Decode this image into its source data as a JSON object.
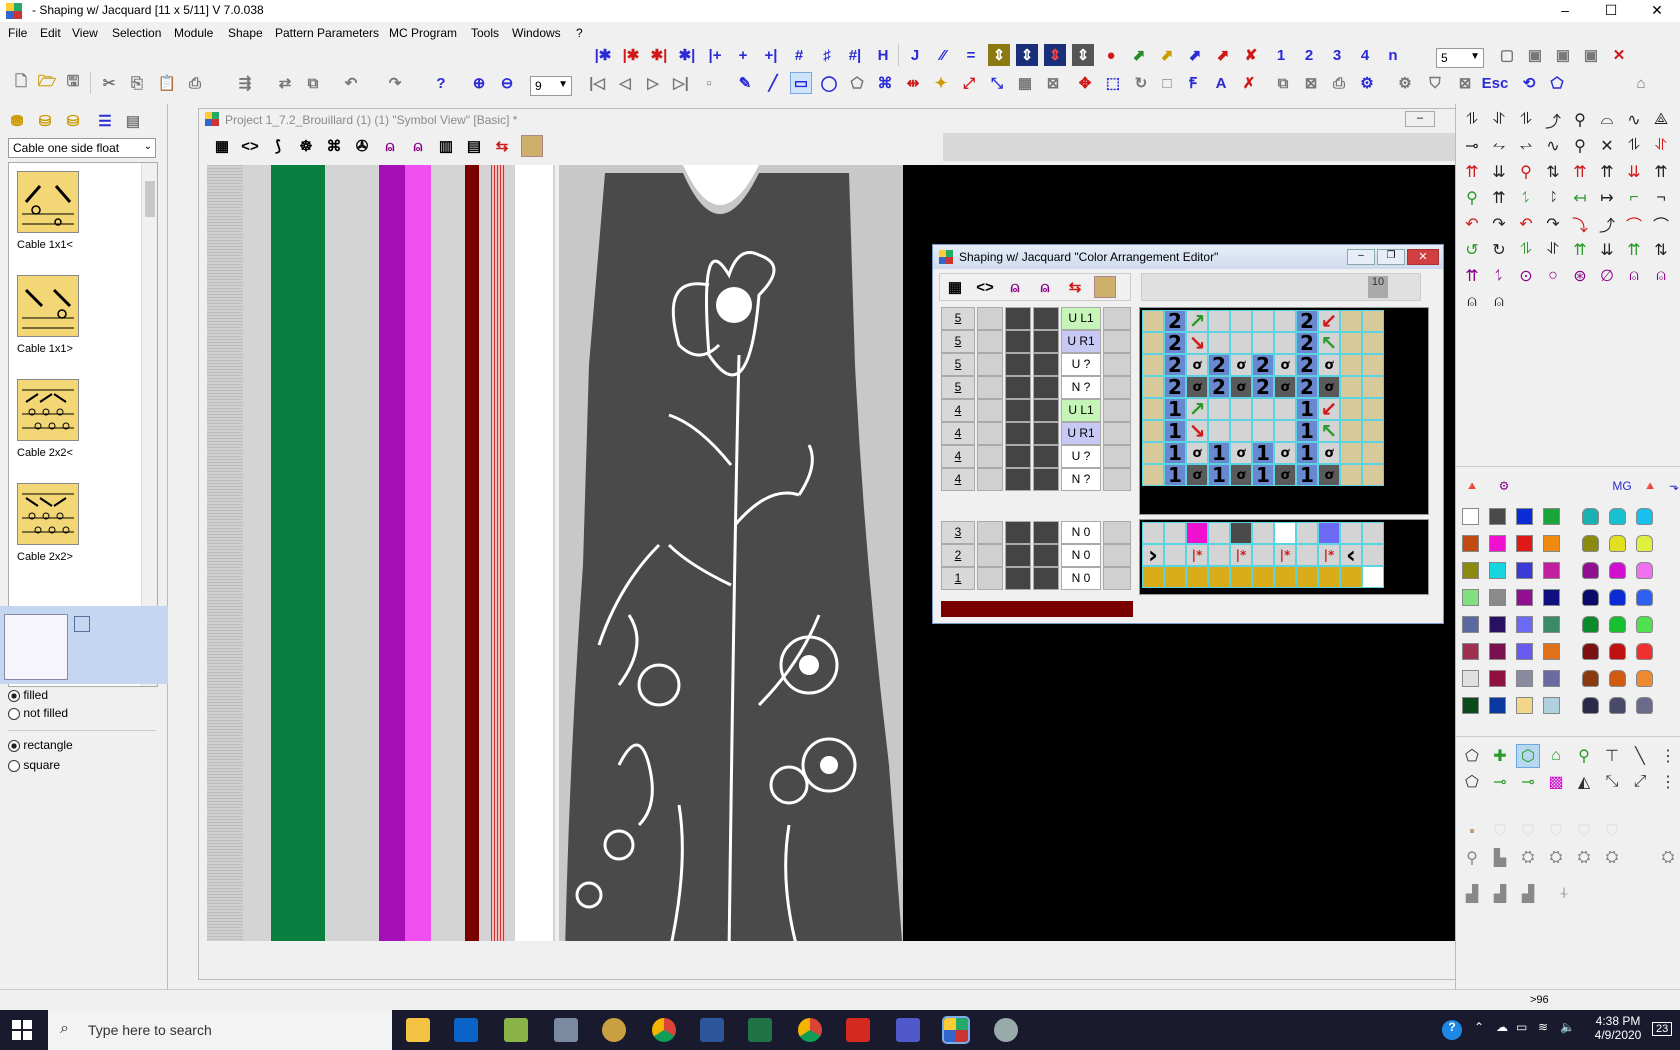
{
  "window": {
    "title": "- Shaping w/ Jacquard [11 x 5/11]   V 7.0.038",
    "min": "–",
    "max": "☐",
    "close": "✕"
  },
  "menu": [
    "File",
    "Edit",
    "View",
    "Selection",
    "Module",
    "Shape",
    "Pattern Parameters",
    "MC Program",
    "Tools",
    "Windows",
    "?"
  ],
  "toolbar": {
    "zoom_value": "9",
    "count_value": "5",
    "numbers": [
      "1",
      "2",
      "3",
      "4",
      "n"
    ],
    "esc_label": "Esc"
  },
  "left_panel": {
    "module_select": "Cable one side float",
    "cables": [
      "Cable 1x1<",
      "Cable 1x1>",
      "Cable 2x2<",
      "Cable 2x2>"
    ],
    "fill_options": [
      "filled",
      "not filled"
    ],
    "fill_selected": "filled",
    "shape_options": [
      "rectangle",
      "square"
    ],
    "shape_selected": "rectangle"
  },
  "document": {
    "title": "Project 1_7.2_Brouillard (1) (1) \"Symbol View\" [Basic] *"
  },
  "colors": {
    "stripes": [
      "#c8c8c8",
      "#d4d4d4",
      "#0a8040",
      "#d4d4d4",
      "#a50fb8",
      "#f050f0",
      "#d4d4d4",
      "#7a0000",
      "#d4d4d4",
      "#ffffff",
      "#d4d4d4"
    ],
    "garment": "#4a4a4a",
    "canvas_bg": "#000000"
  },
  "cae": {
    "title": "Shaping w/ Jacquard \"Color Arrangement Editor\"",
    "ruler_value": "10",
    "rows_top": [
      {
        "num": "5",
        "cmd": "U L1",
        "bg": "#c6f5b8"
      },
      {
        "num": "5",
        "cmd": "U R1",
        "bg": "#c8c8f5"
      },
      {
        "num": "5",
        "cmd": "U ?",
        "bg": "#ffffff"
      },
      {
        "num": "5",
        "cmd": "N ?",
        "bg": "#ffffff"
      },
      {
        "num": "4",
        "cmd": "U L1",
        "bg": "#c6f5b8"
      },
      {
        "num": "4",
        "cmd": "U R1",
        "bg": "#c8c8f5"
      },
      {
        "num": "4",
        "cmd": "U ?",
        "bg": "#ffffff"
      },
      {
        "num": "4",
        "cmd": "N ?",
        "bg": "#ffffff"
      }
    ],
    "rows_bottom": [
      {
        "num": "3",
        "cmd": "N 0",
        "bg": "#ffffff"
      },
      {
        "num": "2",
        "cmd": "N 0",
        "bg": "#ffffff"
      },
      {
        "num": "1",
        "cmd": "N 0",
        "bg": "#ffffff"
      }
    ],
    "grid_rows": [
      [
        "",
        "2",
        "↗",
        "",
        "",
        "",
        "",
        "2",
        "↙",
        "",
        ""
      ],
      [
        "",
        "2",
        "↘",
        "",
        "",
        "",
        "",
        "2",
        "↖",
        "",
        ""
      ],
      [
        "",
        "2",
        "ơ",
        "2",
        "ơ",
        "2",
        "ơ",
        "2",
        "ơ",
        "",
        ""
      ],
      [
        "",
        "2",
        "ơ",
        "2",
        "ơ",
        "2",
        "ơ",
        "2",
        "ơ",
        "",
        ""
      ],
      [
        "",
        "1",
        "↗",
        "",
        "",
        "",
        "",
        "1",
        "↙",
        "",
        ""
      ],
      [
        "",
        "1",
        "↘",
        "",
        "",
        "",
        "",
        "1",
        "↖",
        "",
        ""
      ],
      [
        "",
        "1",
        "ơ",
        "1",
        "ơ",
        "1",
        "ơ",
        "1",
        "ơ",
        "",
        ""
      ],
      [
        "",
        "1",
        "ơ",
        "1",
        "ơ",
        "1",
        "ơ",
        "1",
        "ơ",
        "",
        ""
      ]
    ],
    "bottom_grid": [
      [
        "",
        "",
        "M",
        "",
        "D",
        "",
        "W",
        "",
        "B",
        "",
        ""
      ],
      [
        "›",
        "",
        "|*",
        "",
        "|*",
        "",
        "|*",
        "",
        "|*",
        "‹",
        ""
      ],
      [
        "Y",
        "Y",
        "Y",
        "Y",
        "Y",
        "Y",
        "Y",
        "Y",
        "Y",
        "Y",
        "W"
      ]
    ]
  },
  "status": {
    "right": ">96"
  },
  "taskbar": {
    "search_placeholder": "Type here to search",
    "time": "4:38 PM",
    "date": "4/9/2020",
    "notifications": "23"
  }
}
